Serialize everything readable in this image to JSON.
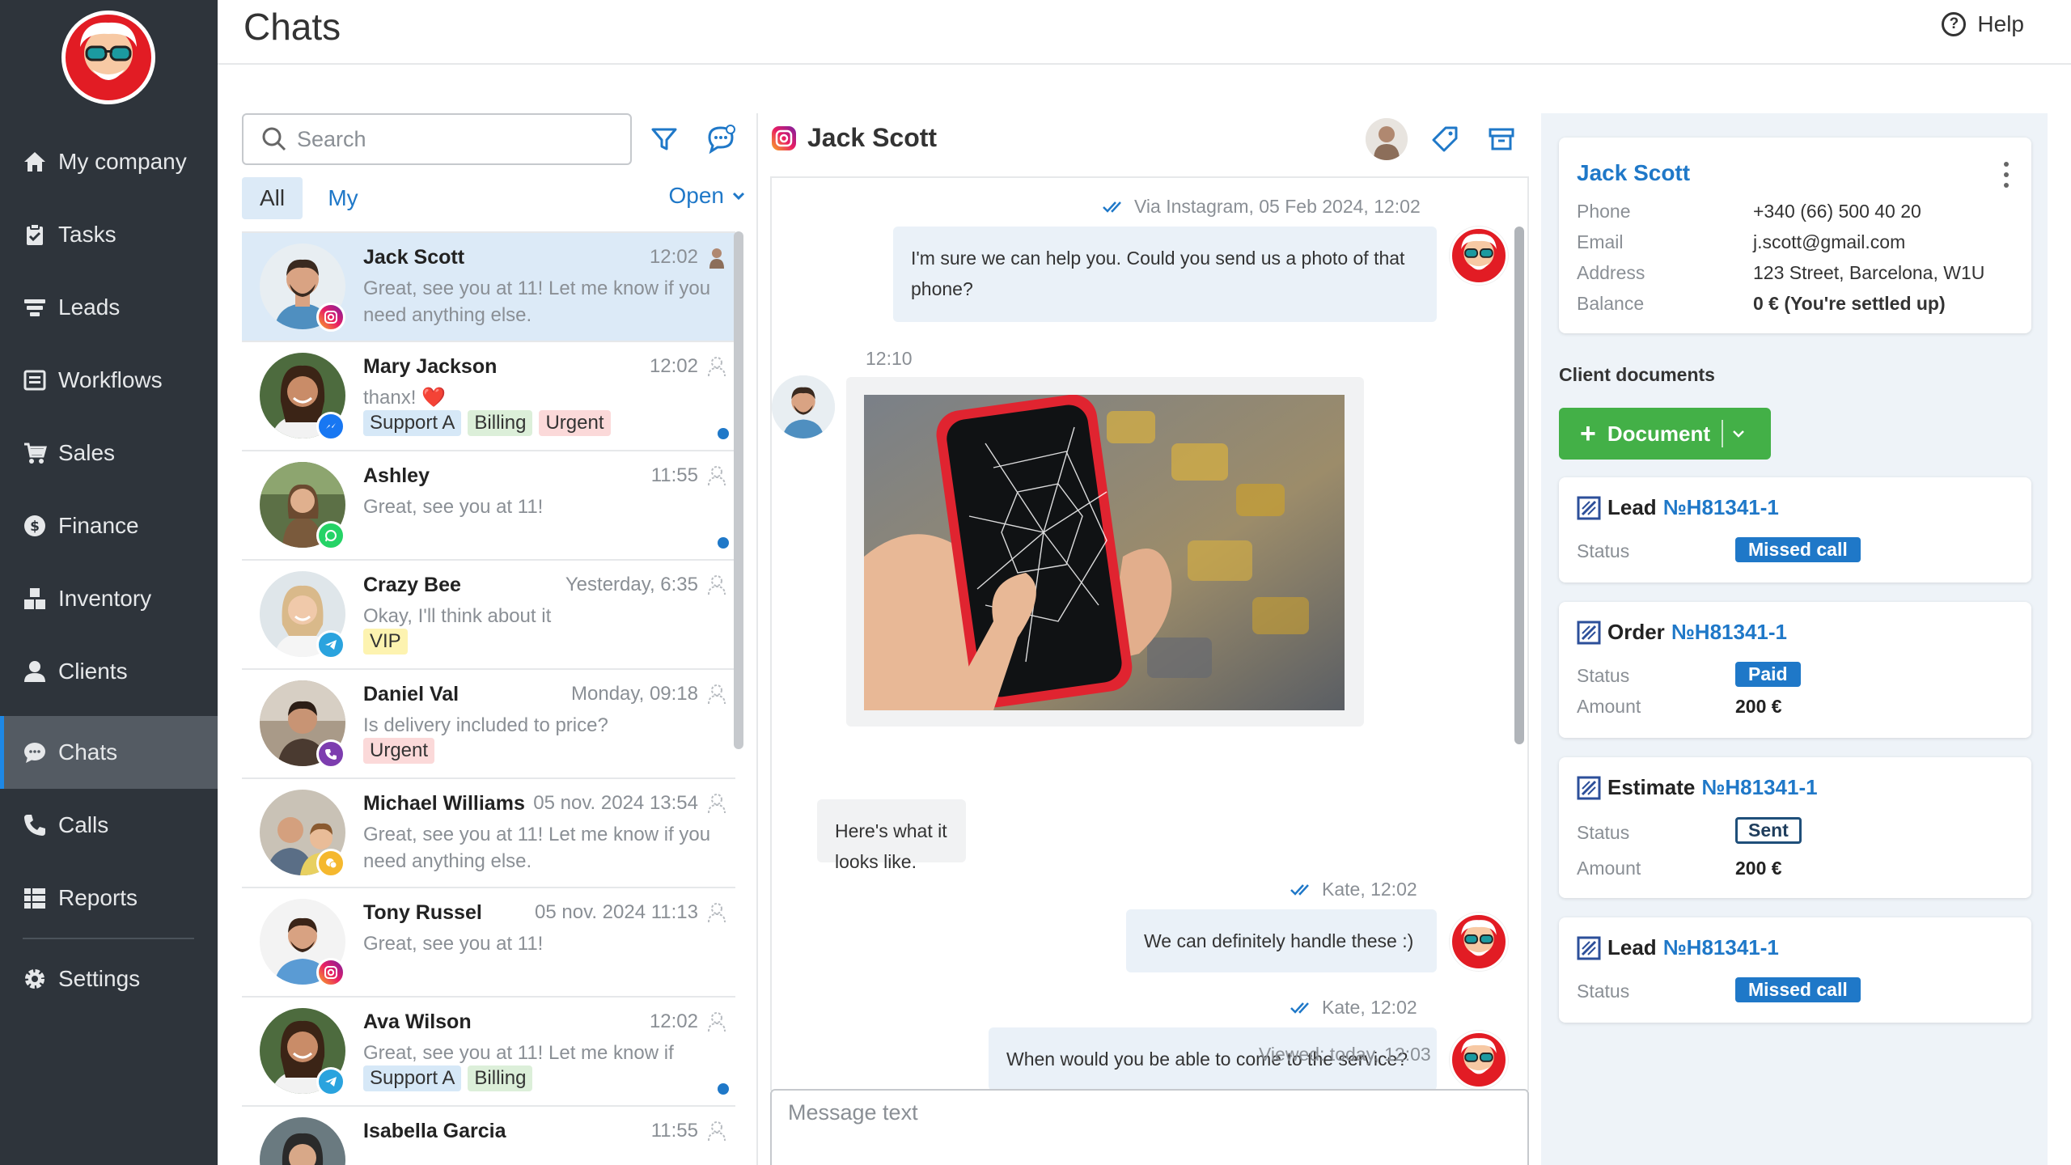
{
  "header": {
    "title": "Chats",
    "help_label": "Help"
  },
  "sidebar": {
    "items": [
      {
        "label": "My company",
        "icon": "home-icon"
      },
      {
        "label": "Tasks",
        "icon": "clipboard-icon"
      },
      {
        "label": "Leads",
        "icon": "funnel-icon"
      },
      {
        "label": "Workflows",
        "icon": "list-icon"
      },
      {
        "label": "Sales",
        "icon": "cart-icon"
      },
      {
        "label": "Finance",
        "icon": "dollar-icon"
      },
      {
        "label": "Inventory",
        "icon": "boxes-icon"
      },
      {
        "label": "Clients",
        "icon": "user-icon"
      },
      {
        "label": "Chats",
        "icon": "chat-icon",
        "active": true
      },
      {
        "label": "Calls",
        "icon": "phone-icon"
      },
      {
        "label": "Reports",
        "icon": "table-icon"
      },
      {
        "label": "Settings",
        "icon": "gear-icon"
      }
    ]
  },
  "list": {
    "search_placeholder": "Search",
    "seg_all": "All",
    "seg_my": "My",
    "open_filter": "Open",
    "chats": [
      {
        "name": "Jack Scott",
        "time": "12:02",
        "preview": "Great, see you at 11! Let me know if you need anything else.",
        "channel": "instagram",
        "tags": [],
        "unread": false,
        "selected": true
      },
      {
        "name": "Mary Jackson",
        "time": "12:02",
        "preview": "thanx! ❤️",
        "channel": "messenger",
        "tags": [
          {
            "label": "Support A",
            "color": "blue"
          },
          {
            "label": "Billing",
            "color": "green"
          },
          {
            "label": "Urgent",
            "color": "red"
          }
        ],
        "unread": true
      },
      {
        "name": "Ashley",
        "time": "11:55",
        "preview": "Great, see you at 11!",
        "channel": "whatsapp",
        "tags": [],
        "unread": true
      },
      {
        "name": "Crazy Bee",
        "time": "Yesterday, 6:35",
        "preview": "Okay, I'll think about it",
        "channel": "telegram",
        "tags": [
          {
            "label": "VIP",
            "color": "yellow"
          }
        ],
        "unread": false
      },
      {
        "name": "Daniel Val",
        "time": "Monday, 09:18",
        "preview": "Is delivery included to price?",
        "channel": "viber",
        "tags": [
          {
            "label": "Urgent",
            "color": "red"
          }
        ],
        "unread": false
      },
      {
        "name": "Michael Williams",
        "time": "05 nov. 2024 13:54",
        "preview": "Great, see you at 11! Let me know if you need anything else.",
        "channel": "chat",
        "tags": [],
        "unread": false
      },
      {
        "name": "Tony Russel",
        "time": "05 nov. 2024 11:13",
        "preview": "Great, see you at 11!",
        "channel": "instagram",
        "tags": [],
        "unread": false
      },
      {
        "name": "Ava Wilson",
        "time": "12:02",
        "preview": "Great, see you at 11! Let me know if yo...",
        "channel": "telegram",
        "tags": [
          {
            "label": "Support A",
            "color": "blue"
          },
          {
            "label": "Billing",
            "color": "green"
          }
        ],
        "unread": true
      },
      {
        "name": "Isabella Garcia",
        "time": "11:55",
        "preview": "",
        "channel": "whatsapp",
        "tags": [],
        "unread": false
      }
    ]
  },
  "conversation": {
    "title": "Jack Scott",
    "meta1": "Via Instagram, 05 Feb 2024, 12:02",
    "msg1": "I'm sure we can help you. Could you send us a photo of that phone?",
    "time_in": "12:10",
    "msg_in": "Here's what it looks like.",
    "meta2": "Kate, 12:02",
    "msg2": "We can definitely handle these :)",
    "meta3": "Kate, 12:02",
    "msg3": "When would you be able to come to the service?",
    "viewed": "Viewed: today, 12:03",
    "composer_placeholder": "Message text"
  },
  "client": {
    "name": "Jack Scott",
    "fields": [
      {
        "label": "Phone",
        "value": "+340 (66) 500 40 20"
      },
      {
        "label": "Email",
        "value": "j.scott@gmail.com"
      },
      {
        "label": "Address",
        "value": "123 Street, Barcelona, W1U"
      },
      {
        "label": "Balance",
        "value": "0 € (You're settled up)"
      }
    ],
    "documents_title": "Client documents",
    "add_document": "Document",
    "documents": [
      {
        "type": "Lead",
        "number": "№H81341-1",
        "status_label": "Status",
        "status": "Missed call",
        "badge": "filled"
      },
      {
        "type": "Order",
        "number": "№H81341-1",
        "status_label": "Status",
        "status": "Paid",
        "badge": "filled",
        "amount_label": "Amount",
        "amount": "200 €"
      },
      {
        "type": "Estimate",
        "number": "№H81341-1",
        "status_label": "Status",
        "status": "Sent",
        "badge": "outline",
        "amount_label": "Amount",
        "amount": "200 €"
      },
      {
        "type": "Lead",
        "number": "№H81341-1",
        "status_label": "Status",
        "status": "Missed call",
        "badge": "filled"
      }
    ]
  },
  "colors": {
    "sidebar": "#2e343b",
    "accent": "#1f78c8",
    "green": "#43b047",
    "brand_red": "#e21c24"
  }
}
